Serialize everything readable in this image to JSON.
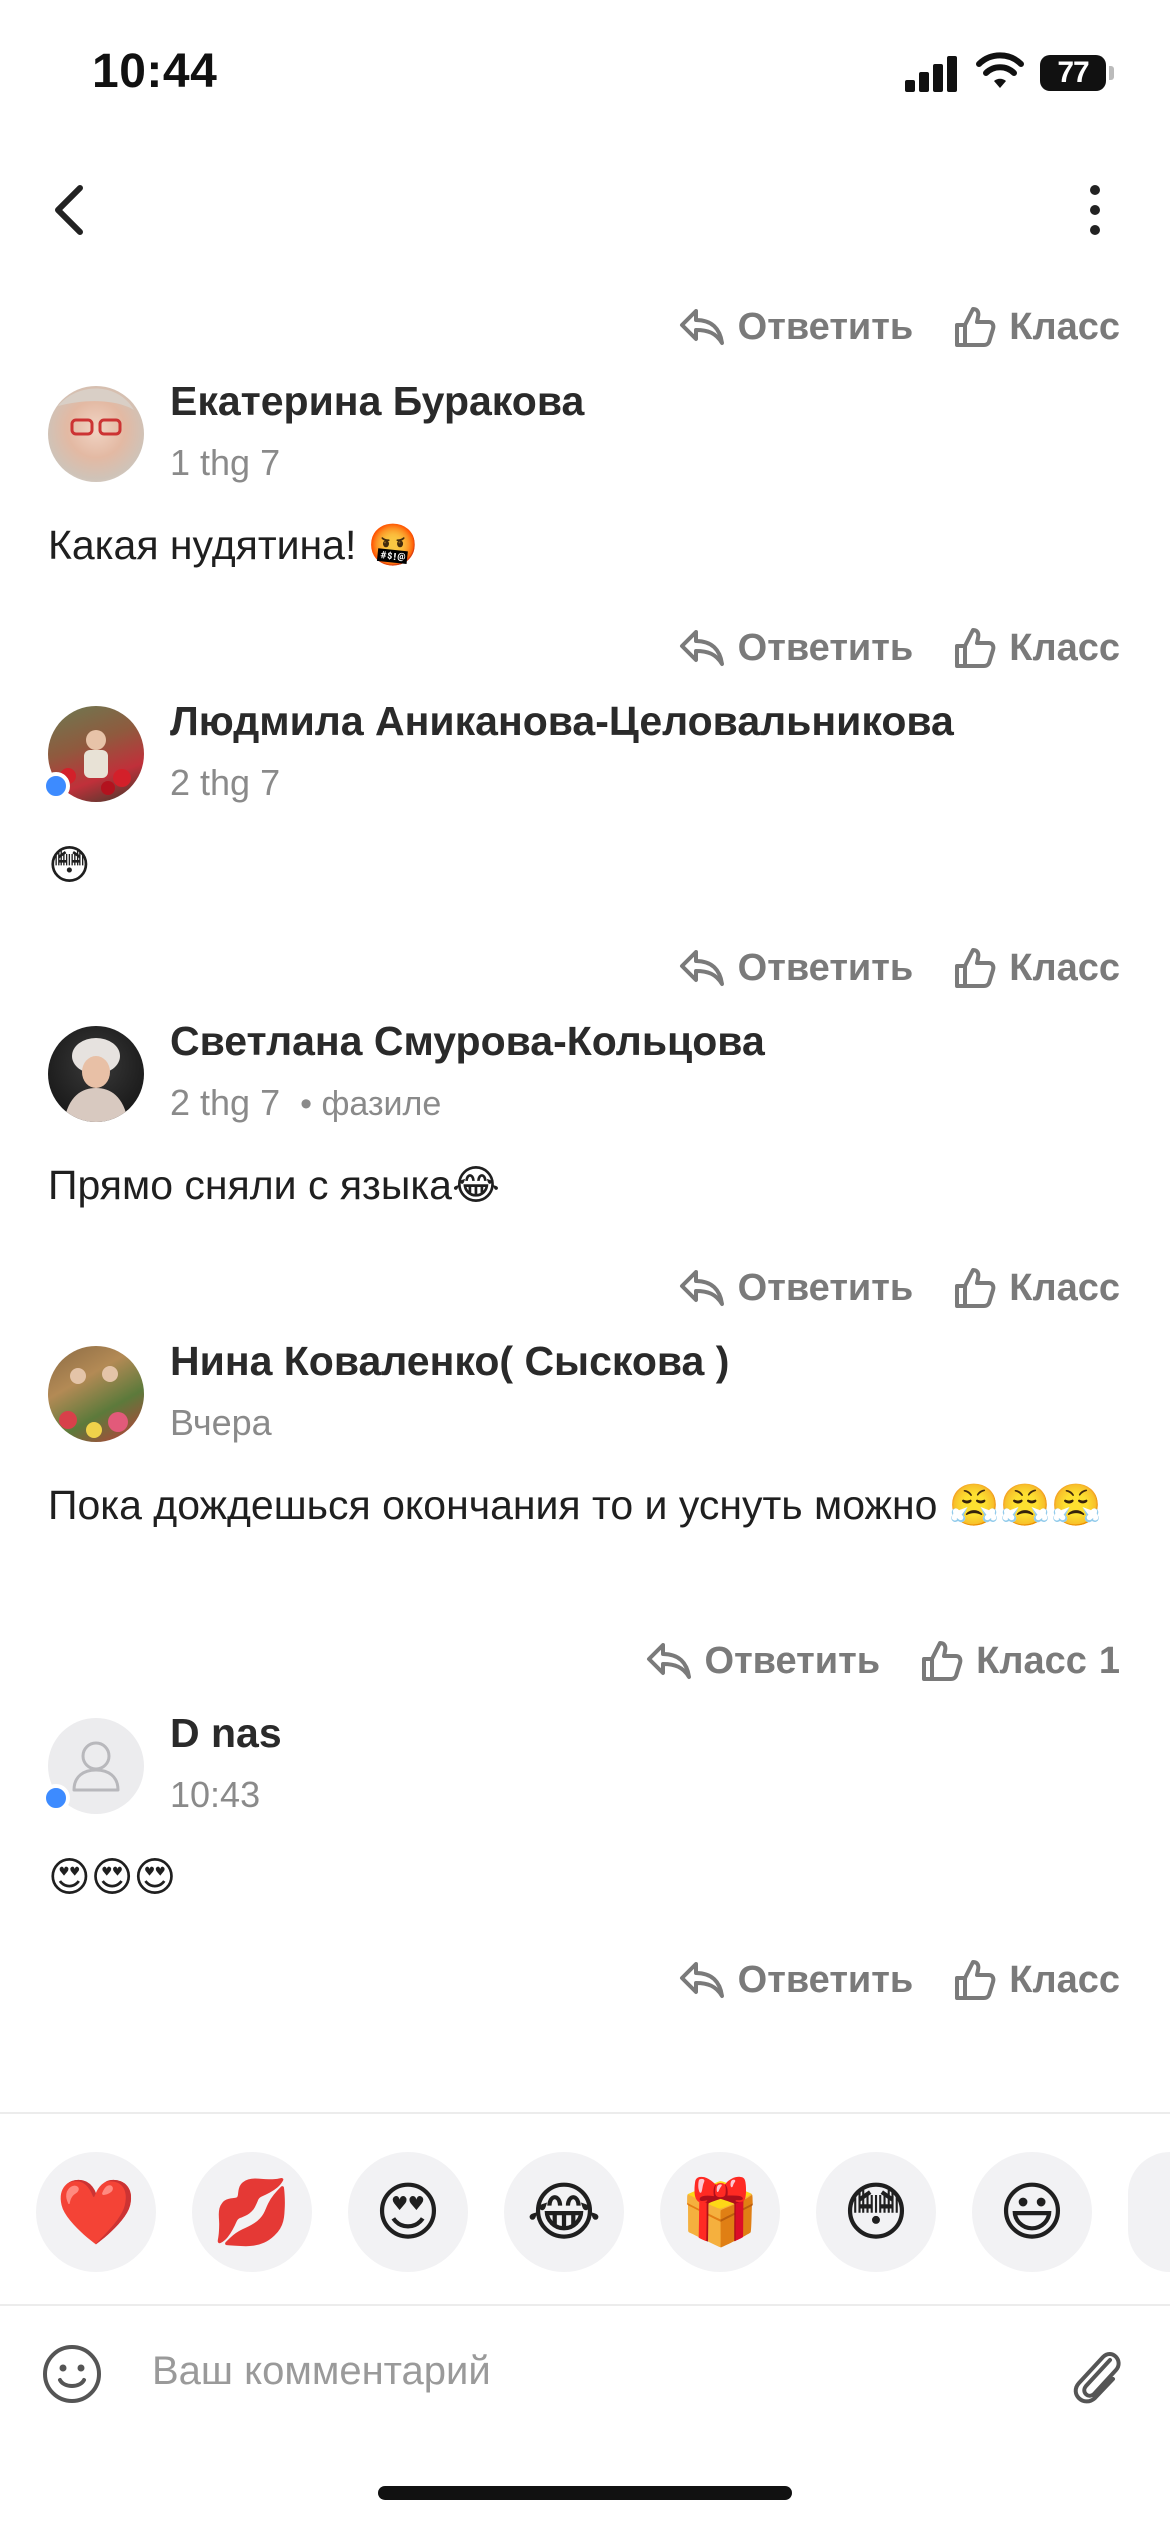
{
  "status_bar": {
    "time": "10:44",
    "battery": "77"
  },
  "actions": {
    "reply_label": "Ответить",
    "like_label": "Класс"
  },
  "comments": [
    {
      "author": "Екатерина Буракова",
      "time": "1 thg 7",
      "text": "Какая нудятина! 🤬",
      "online": false,
      "likes": ""
    },
    {
      "author": "Людмила Аниканова-Целовальникова",
      "time": "2 thg 7",
      "text": "😳",
      "online": true,
      "likes": ""
    },
    {
      "author": "Светлана Смурова-Кольцова",
      "time": "2 thg 7",
      "extra": "• фазиле",
      "text": "Прямо сняли с языка😂",
      "online": false,
      "likes": ""
    },
    {
      "author": "Нина Коваленко( Сыскова )",
      "time": "Вчера",
      "text": "Пока дождешься окончания то и уснуть можно 😤😤😤",
      "online": false,
      "likes": "1"
    },
    {
      "author": "D nas",
      "time": "10:43",
      "text": "😍😍😍",
      "online": true,
      "likes": ""
    }
  ],
  "emoji_bar": [
    "❤️",
    "💋",
    "😍",
    "😂",
    "🎁",
    "😳",
    "😃"
  ],
  "composer": {
    "placeholder": "Ваш комментарий"
  },
  "colors": {
    "accent": "#3d8bff",
    "muted": "#7a7a7a"
  },
  "icons": [
    "back-icon",
    "more-icon",
    "reply-icon",
    "like-icon",
    "smile-icon",
    "attach-icon",
    "signal-icon",
    "wifi-icon"
  ]
}
